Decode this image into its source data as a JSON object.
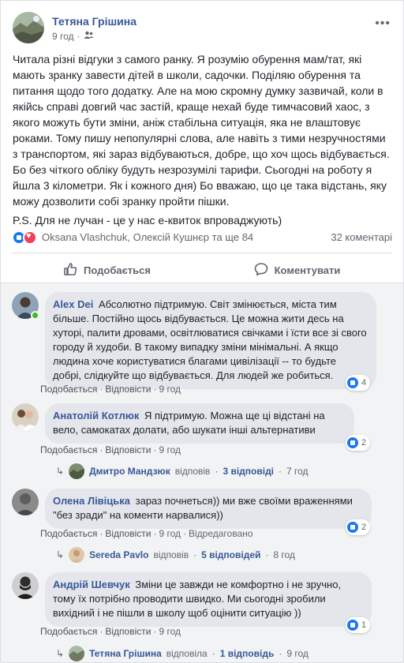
{
  "post": {
    "author": "Тетяна Грішина",
    "time": "9 год",
    "more_icon": "•••",
    "paragraphs": [
      "Читала різні відгуки з самого ранку. Я розумію обурення мам/тат, які мають зранку завести дітей в школи, садочки. Поділяю обурення та питання щодо того додатку. Але на мою скромну думку зазвичай, коли в якійсь справі довгий час застій, краще нехай буде тимчасовий хаос, з якого можуть бути зміни, аніж стабільна ситуація, яка не влаштовує роками. Тому пишу непопулярні слова, але навіть з тими незручностями з транспортом, які зараз відбуваються, добре, що хоч щось відбувається. Бо без чіткого обліку будуть незрозумілі тарифи. Сьогодні на роботу я йшла 3 кілометри. Як і кожного дня) Бо вважаю, що це така відстань, яку можу дозволити собі зранку пройти пішки.",
      "P.S. Для не лучан - це у нас е-квиток впроваджують)"
    ],
    "reactions_text": "Oksana Vlashchuk, Олексій Кушнєр та ще 84",
    "comments_count": "32 коментарі",
    "like_label": "Подобається",
    "comment_label": "Коментувати"
  },
  "comments": [
    {
      "name": "Alex Dei",
      "text": "Абсолютно підтримую. Світ змінюється, міста тим більше. Постійно щось відбувається. Це можна жити десь на хуторі, палити дровами, освітлюватися свічками і їсти все зі свого городу й худоби. В такому випадку зміни мінімальні. А якщо людина хоче користуватися благами цивілізації -- то будьте добрі, слідкуйте що відбувається. Для людей же робиться.",
      "like": "Подобається",
      "reply": "Відповісти",
      "time": "9 год",
      "reactions": "4"
    },
    {
      "name": "Анатолій Котлюк",
      "text": "Я підтримую. Можна ще ці відстані на вело, самокатах долати, або шукати інші альтернативи",
      "like": "Подобається",
      "reply": "Відповісти",
      "time": "9 год",
      "reactions": "2",
      "replies": {
        "who": "Дмитро Мандзюк",
        "verb": "відповів",
        "count": "3 відповіді",
        "time": "7 год"
      }
    },
    {
      "name": "Олена Лівіцька",
      "text": "зараз почнеться)) ми вже своїми враженнями \"без зради\" на коменти нарвалися))",
      "like": "Подобається",
      "reply": "Відповісти",
      "time": "9 год",
      "edited": "Відредаговано",
      "reactions": "2",
      "replies": {
        "who": "Sereda Pavlo",
        "verb": "відповів",
        "count": "5 відповідей",
        "time": "8 год"
      }
    },
    {
      "name": "Андрій Шевчук",
      "text": "Зміни це завжди не комфортно і не зручно, тому їх потрібно проводити швидко. Ми сьогодні зробили вихідний і не пішли в школу щоб оцінити ситуацію ))",
      "like": "Подобається",
      "reply": "Відповісти",
      "time": "9 год",
      "reactions": "1",
      "replies": {
        "who": "Тетяна Грішина",
        "verb": "відповіла",
        "count": "1 відповідь",
        "time": "9 год"
      }
    }
  ]
}
